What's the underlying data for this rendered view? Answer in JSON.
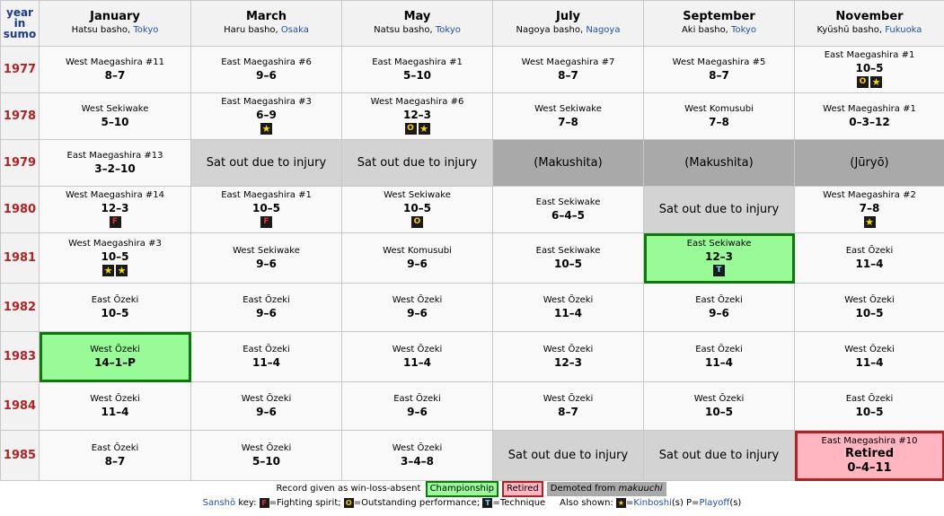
{
  "header": {
    "year_col": [
      "year",
      "in",
      "sumo"
    ],
    "bashos": [
      {
        "name": "January",
        "sub": "Hatsu basho, ",
        "loc": "Tokyo"
      },
      {
        "name": "March",
        "sub": "Haru basho, ",
        "loc": "Osaka"
      },
      {
        "name": "May",
        "sub": "Natsu basho, ",
        "loc": "Tokyo"
      },
      {
        "name": "July",
        "sub": "Nagoya basho, ",
        "loc": "Nagoya"
      },
      {
        "name": "September",
        "sub": "Aki basho, ",
        "loc": "Tokyo"
      },
      {
        "name": "November",
        "sub": "Kyūshū basho, ",
        "loc": "Fukuoka"
      }
    ]
  },
  "rows": [
    {
      "year": "1977",
      "cells": [
        {
          "rank": "West Maegashira #11",
          "record": "8–7"
        },
        {
          "rank": "East Maegashira #6",
          "record": "9–6"
        },
        {
          "rank": "East Maegashira #1",
          "record": "5–10"
        },
        {
          "rank": "West Maegashira #7",
          "record": "8–7"
        },
        {
          "rank": "West Maegashira #5",
          "record": "8–7"
        },
        {
          "rank": "East Maegashira #1",
          "record": "10–5",
          "badges": [
            "O",
            "K"
          ]
        }
      ]
    },
    {
      "year": "1978",
      "cells": [
        {
          "rank": "West Sekiwake",
          "record": "5–10"
        },
        {
          "rank": "East Maegashira #3",
          "record": "6–9",
          "badges": [
            "K"
          ]
        },
        {
          "rank": "West Maegashira #6",
          "record": "12–3",
          "badges": [
            "O",
            "K"
          ]
        },
        {
          "rank": "West Sekiwake",
          "record": "7–8"
        },
        {
          "rank": "West Komusubi",
          "record": "7–8"
        },
        {
          "rank": "West Maegashira #1",
          "record": "0–3–12"
        }
      ]
    },
    {
      "year": "1979",
      "cells": [
        {
          "rank": "East Maegashira #13",
          "record": "3–2–10"
        },
        {
          "type": "sat",
          "text": "Sat out due to injury"
        },
        {
          "type": "sat",
          "text": "Sat out due to injury"
        },
        {
          "type": "demoted",
          "text": "(Makushita)"
        },
        {
          "type": "demoted",
          "text": "(Makushita)"
        },
        {
          "type": "demoted",
          "text": "(Jūryō)"
        }
      ]
    },
    {
      "year": "1980",
      "cells": [
        {
          "rank": "West Maegashira #14",
          "record": "12–3",
          "badges": [
            "F"
          ]
        },
        {
          "rank": "East Maegashira #1",
          "record": "10–5",
          "badges": [
            "F"
          ]
        },
        {
          "rank": "West Sekiwake",
          "record": "10–5",
          "badges": [
            "O"
          ]
        },
        {
          "rank": "East Sekiwake",
          "record": "6–4–5"
        },
        {
          "type": "sat",
          "text": "Sat out due to injury"
        },
        {
          "rank": "West Maegashira #2",
          "record": "7–8",
          "badges": [
            "K"
          ]
        }
      ]
    },
    {
      "year": "1981",
      "cells": [
        {
          "rank": "West Maegashira #3",
          "record": "10–5",
          "badges": [
            "K",
            "K"
          ]
        },
        {
          "rank": "West Sekiwake",
          "record": "9–6"
        },
        {
          "rank": "West Komusubi",
          "record": "9–6"
        },
        {
          "rank": "East Sekiwake",
          "record": "10–5"
        },
        {
          "rank": "East Sekiwake",
          "record": "12–3",
          "badges": [
            "T"
          ],
          "type": "champ"
        },
        {
          "rank": "East Ōzeki",
          "record": "11–4"
        }
      ]
    },
    {
      "year": "1982",
      "cells": [
        {
          "rank": "East Ōzeki",
          "record": "10–5"
        },
        {
          "rank": "East Ōzeki",
          "record": "9–6"
        },
        {
          "rank": "West Ōzeki",
          "record": "9–6"
        },
        {
          "rank": "West Ōzeki",
          "record": "11–4"
        },
        {
          "rank": "East Ōzeki",
          "record": "9–6"
        },
        {
          "rank": "West Ōzeki",
          "record": "10–5"
        }
      ]
    },
    {
      "year": "1983",
      "cells": [
        {
          "rank": "West Ōzeki",
          "record": "14–1–P",
          "type": "champ"
        },
        {
          "rank": "East Ōzeki",
          "record": "11–4"
        },
        {
          "rank": "West Ōzeki",
          "record": "11–4"
        },
        {
          "rank": "West Ōzeki",
          "record": "12–3"
        },
        {
          "rank": "East Ōzeki",
          "record": "11–4"
        },
        {
          "rank": "West Ōzeki",
          "record": "11–4"
        }
      ]
    },
    {
      "year": "1984",
      "cells": [
        {
          "rank": "West Ōzeki",
          "record": "11–4"
        },
        {
          "rank": "West Ōzeki",
          "record": "9–6"
        },
        {
          "rank": "East Ōzeki",
          "record": "9–6"
        },
        {
          "rank": "West Ōzeki",
          "record": "8–7"
        },
        {
          "rank": "West Ōzeki",
          "record": "10–5"
        },
        {
          "rank": "East Ōzeki",
          "record": "10–5"
        }
      ]
    },
    {
      "year": "1985",
      "cells": [
        {
          "rank": "East Ōzeki",
          "record": "8–7"
        },
        {
          "rank": "West Ōzeki",
          "record": "5–10"
        },
        {
          "rank": "West Ōzeki",
          "record": "3–4–8"
        },
        {
          "type": "sat",
          "text": "Sat out due to injury"
        },
        {
          "type": "sat",
          "text": "Sat out due to injury"
        },
        {
          "rank": "East Maegashira #10",
          "record": "Retired",
          "record2": "0–4–11",
          "type": "retired"
        }
      ]
    }
  ],
  "legend": {
    "line1_text": "Record given as win-loss-absent",
    "championship": "Championship",
    "retired": "Retired",
    "demoted_prefix": "Demoted from ",
    "demoted_em": "makuuchi",
    "sansho_link": "Sanshō",
    "key_label": " key: ",
    "f_text": "=Fighting spirit; ",
    "o_text": "=Outstanding performance; ",
    "t_text": "=Technique",
    "also_shown": "Also shown: ",
    "kinboshi_eq": "=",
    "kinboshi_link": "Kinboshi",
    "kinboshi_suffix": "(s) P=",
    "playoff_link": "Playoff",
    "playoff_suffix": "(s)"
  },
  "badge_glyphs": {
    "F": "F",
    "O": "O",
    "T": "T",
    "K": "★"
  },
  "colors": {
    "champ": "#98fb98",
    "retired": "#ffb6c1",
    "sat": "#d3d3d3",
    "demoted": "#a9a9a9",
    "year": "#b22222",
    "link": "#1e50a2"
  }
}
